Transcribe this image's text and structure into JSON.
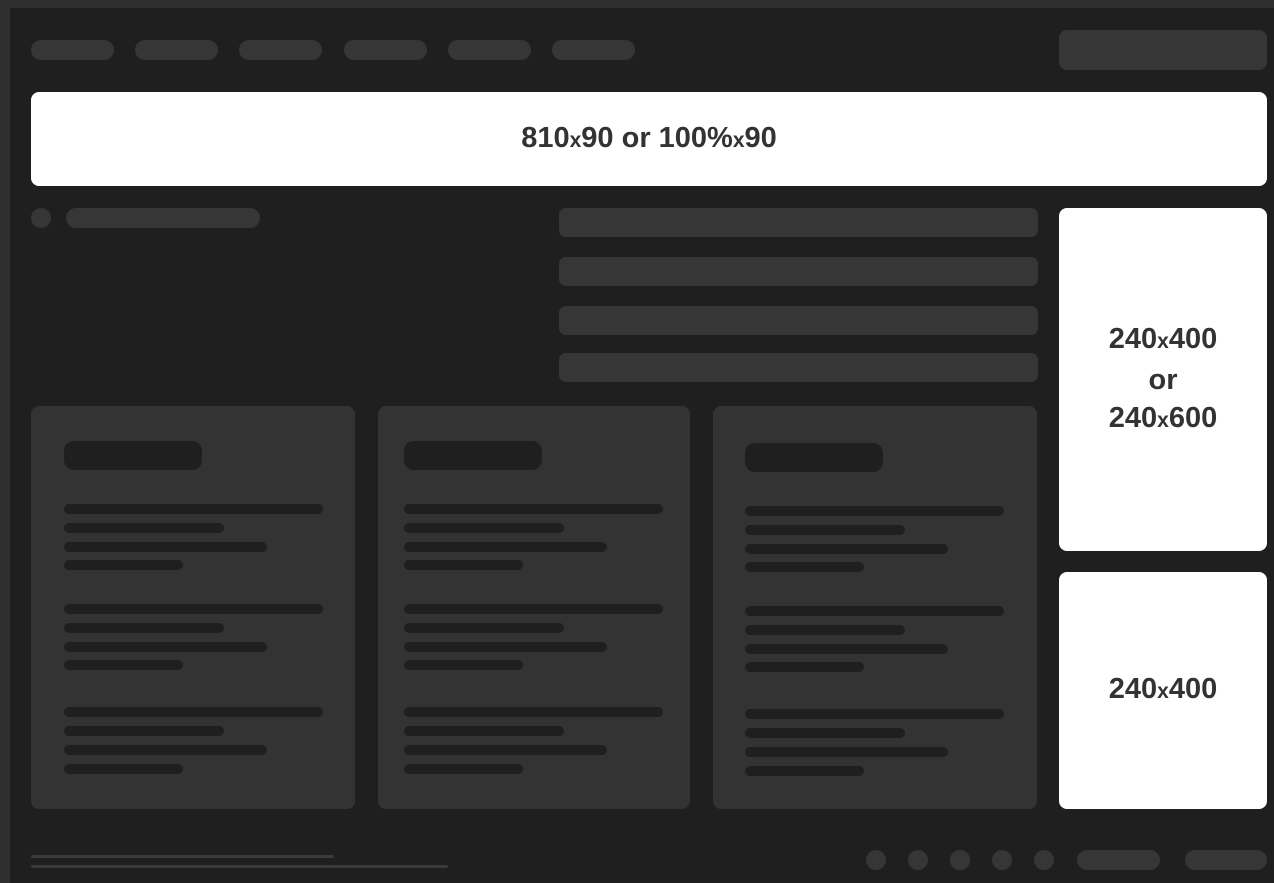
{
  "ads": {
    "leaderboard": {
      "w": "810",
      "sep": "x",
      "h": "90",
      "or": "or",
      "w2": "100%",
      "sep2": "x",
      "h2": "90"
    },
    "skyscraper": {
      "line1_w": "240",
      "line1_sep": "x",
      "line1_h": "400",
      "or": "or",
      "line2_w": "240",
      "line2_sep": "x",
      "line2_h": "600"
    },
    "rectangle": {
      "w": "240",
      "sep": "x",
      "h": "400"
    }
  },
  "colors": {
    "background": "#1f1f1f",
    "placeholder": "#363636",
    "card": "#333333",
    "ad_slot": "#ffffff",
    "ad_text": "#333333"
  }
}
